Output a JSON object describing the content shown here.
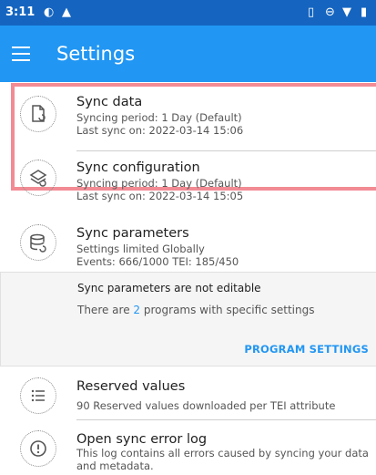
{
  "status_bar": {
    "time": "3:11"
  },
  "app_bar": {
    "title": "Settings"
  },
  "sync_data": {
    "title": "Sync data",
    "period": "Syncing period: 1 Day (Default)",
    "last_sync": "Last sync on: 2022-03-14 15:06"
  },
  "sync_configuration": {
    "title": "Sync configuration",
    "period": "Syncing period: 1 Day (Default)",
    "last_sync": "Last sync on: 2022-03-14 15:05"
  },
  "sync_parameters": {
    "title": "Sync parameters",
    "limit": "Settings limited Globally",
    "events": "Events: 666/1000 TEI: 185/450"
  },
  "sync_card": {
    "not_editable": "Sync parameters are not editable",
    "programs_prefix": "There are",
    "programs_count": "2",
    "programs_suffix": "programs with specific settings",
    "button": "PROGRAM SETTINGS"
  },
  "reserved_values": {
    "title": "Reserved values",
    "subtitle": "90 Reserved values downloaded per TEI attribute"
  },
  "error_log": {
    "title": "Open sync error log",
    "line1": "This log contains all errors caused by syncing your data",
    "line2": "and metadata."
  },
  "colors": {
    "app_bar": "#2196f3",
    "status_bar": "#1565c0",
    "highlight": "#f28b94",
    "accent": "#2196f3"
  },
  "icons": [
    "menu-icon",
    "sync-data-icon",
    "sync-config-icon",
    "sync-parameters-icon",
    "reserved-values-icon",
    "error-log-icon"
  ]
}
